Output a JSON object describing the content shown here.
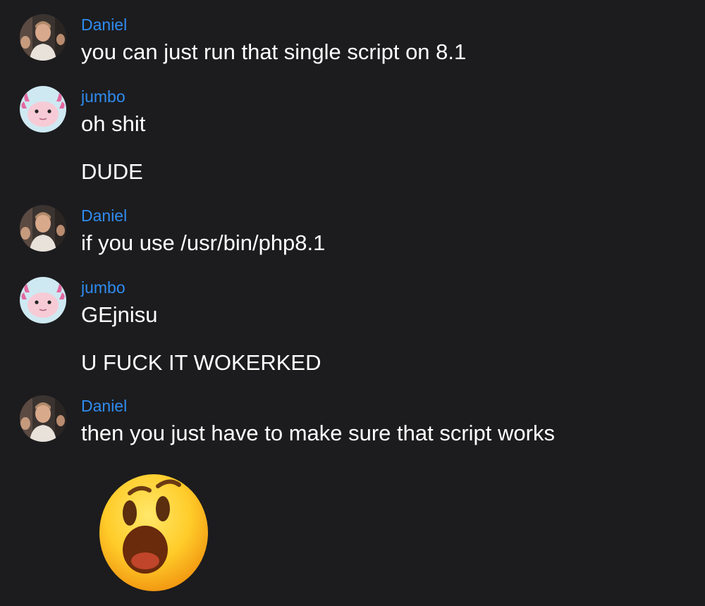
{
  "colors": {
    "background": "#1c1c1e",
    "sender_name": "#2f8cf0",
    "message_text": "#ffffff"
  },
  "messages": [
    {
      "sender": "Daniel",
      "avatar": "daniel-avatar",
      "lines": [
        "you can just run that single script on 8.1"
      ]
    },
    {
      "sender": "jumbo",
      "avatar": "axolotl-avatar",
      "lines": [
        "oh shit",
        "DUDE"
      ]
    },
    {
      "sender": "Daniel",
      "avatar": "daniel-avatar",
      "lines": [
        "if you use /usr/bin/php8.1"
      ]
    },
    {
      "sender": "jumbo",
      "avatar": "axolotl-avatar",
      "lines": [
        "GEjnisu",
        "U FUCK IT WOKERKED"
      ]
    },
    {
      "sender": "Daniel",
      "avatar": "daniel-avatar",
      "lines": [
        "then you just have to make sure that script works"
      ]
    }
  ],
  "reaction_emoji": "surprised-face-emoji"
}
